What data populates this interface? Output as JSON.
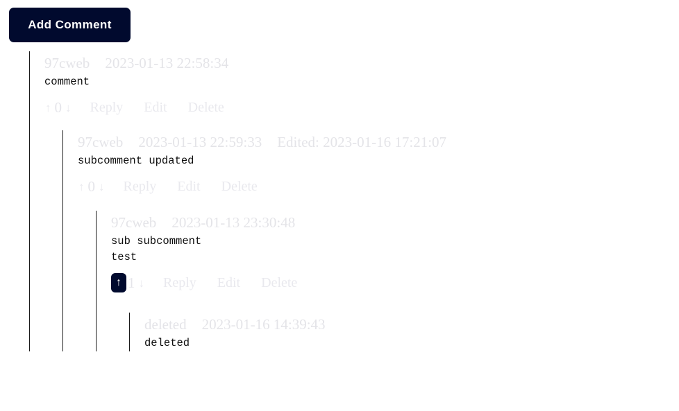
{
  "toolbar": {
    "add_comment_label": "Add Comment"
  },
  "colors": {
    "accent": "#010a2e",
    "button_text": "#ffffff",
    "header_text": "#e4e4e8",
    "body_text": "#0d0d0d",
    "action_text": "#e9e9ee",
    "thread_line": "#1a1a1a",
    "background": "#ffffff"
  },
  "action_labels": {
    "reply": "Reply",
    "edit": "Edit",
    "delete": "Delete",
    "upvote_icon": "↑",
    "downvote_icon": "↓"
  },
  "comments": [
    {
      "author": "97cweb",
      "timestamp": "2023-01-13 22:58:34",
      "edited": "",
      "text": "comment",
      "score": "0",
      "upvote_focused": false
    },
    {
      "author": "97cweb",
      "timestamp": "2023-01-13 22:59:33",
      "edited": "Edited: 2023-01-16 17:21:07",
      "text": "subcomment updated",
      "score": "0",
      "upvote_focused": false
    },
    {
      "author": "97cweb",
      "timestamp": "2023-01-13 23:30:48",
      "edited": "",
      "text": "sub subcomment\ntest",
      "score": "1",
      "upvote_focused": true
    },
    {
      "author": "deleted",
      "timestamp": "2023-01-16 14:39:43",
      "edited": "",
      "text": "deleted",
      "score": "",
      "upvote_focused": false,
      "hide_actions": true
    }
  ]
}
